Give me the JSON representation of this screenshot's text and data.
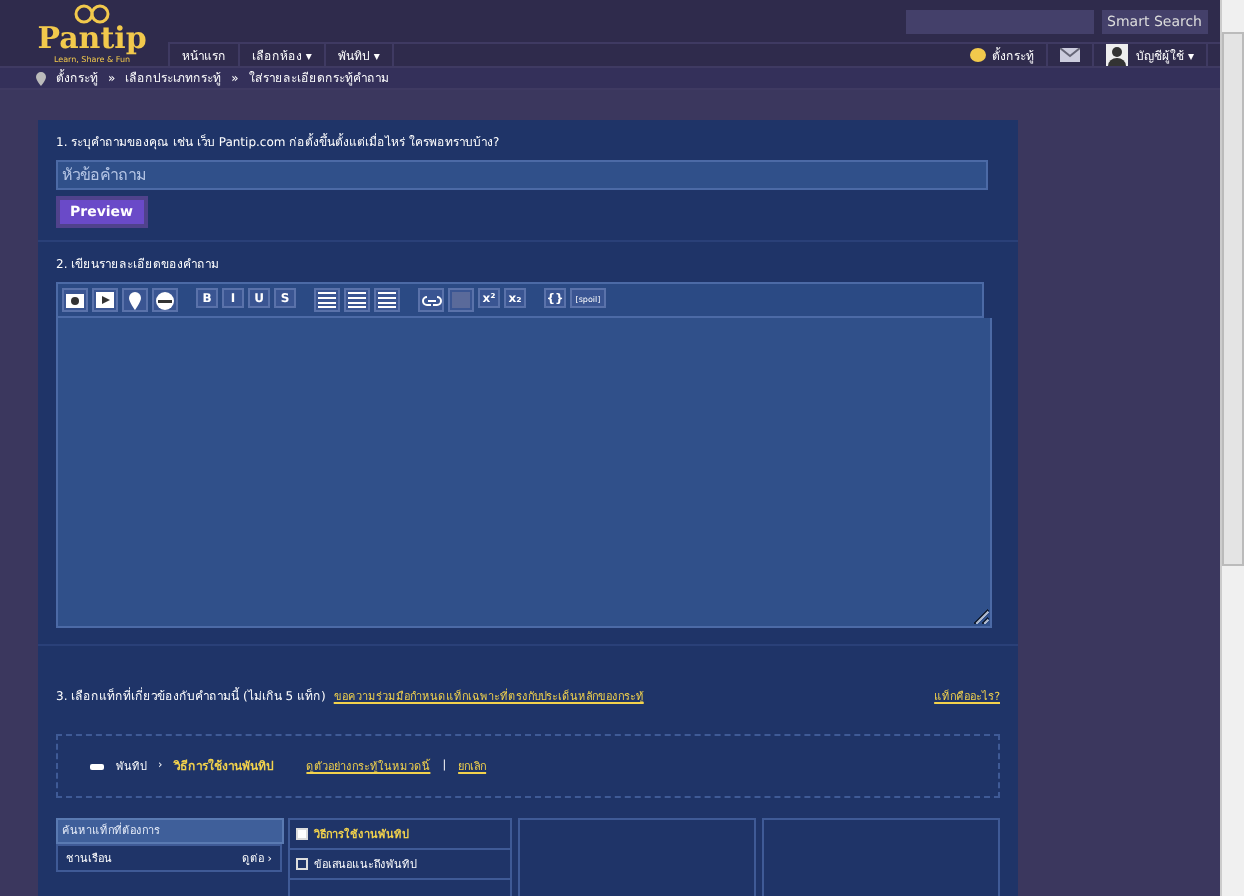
{
  "header": {
    "logo": "Pantip",
    "tagline": "Learn, Share & Fun",
    "search_button": "Smart Search",
    "nav": [
      "หน้าแรก",
      "เลือกห้อง ▾",
      "พันทิป ▾"
    ],
    "post_label": "ตั้งกระทู้",
    "account_label": "บัญชีผู้ใช้ ▾"
  },
  "breadcrumb": [
    "ตั้งกระทู้",
    "»",
    "เลือกประเภทกระทู้",
    "»",
    "ใส่รายละเอียดกระทู้คำถาม"
  ],
  "step1": {
    "label": "1. ระบุคำถามของคุณ เช่น เว็บ Pantip.com ก่อตั้งขึ้นตั้งแต่เมื่อไหร่ ใครพอทราบบ้าง?",
    "placeholder": "หัวข้อคำถาม",
    "preview": "Preview"
  },
  "step2": {
    "label": "2. เขียนรายละเอียดของคำถาม",
    "toolbar": [
      {
        "kind": "image"
      },
      {
        "kind": "video"
      },
      {
        "kind": "map"
      },
      {
        "kind": "emoticon"
      },
      {
        "kind": "sep"
      },
      {
        "kind": "text",
        "text": "B"
      },
      {
        "kind": "text",
        "text": "I"
      },
      {
        "kind": "text",
        "text": "U"
      },
      {
        "kind": "text",
        "text": "S"
      },
      {
        "kind": "sep"
      },
      {
        "kind": "align"
      },
      {
        "kind": "align"
      },
      {
        "kind": "align"
      },
      {
        "kind": "sep"
      },
      {
        "kind": "link"
      },
      {
        "kind": "rule"
      },
      {
        "kind": "text",
        "text": "x²"
      },
      {
        "kind": "text",
        "text": "x₂"
      },
      {
        "kind": "sep"
      },
      {
        "kind": "text",
        "text": "{}"
      },
      {
        "kind": "text",
        "text": "[spoil]"
      }
    ]
  },
  "step3": {
    "label": "3. เลือกแท็กที่เกี่ยวข้องกับคำถามนี้ (ไม่เกิน 5 แท็ก)",
    "guideline_link": "ขอความร่วมมือกำหนดแท็กเฉพาะที่ตรงกับประเด็นหลักของกระทู้",
    "help_link": "แท็กคืออะไร?",
    "path": [
      "พันทิป",
      "›"
    ],
    "current_tag": "วิธีการใช้งานพันทิป",
    "examples_link": "ดูตัวอย่างกระทู้ในหมวดนี้",
    "divider": "|",
    "cancel_link": "ยกเลิก",
    "tag_search": {
      "placeholder": "ค้นหาแท็กที่ต้องการ"
    },
    "tag_list": [
      {
        "name": "ชานเรือน",
        "more": "ดูต่อ ›"
      }
    ],
    "tag_options": [
      {
        "name": "วิธีการใช้งานพันทิป",
        "checked": true
      },
      {
        "name": "ข้อเสนอแนะถึงพันทิป",
        "checked": false
      }
    ]
  }
}
